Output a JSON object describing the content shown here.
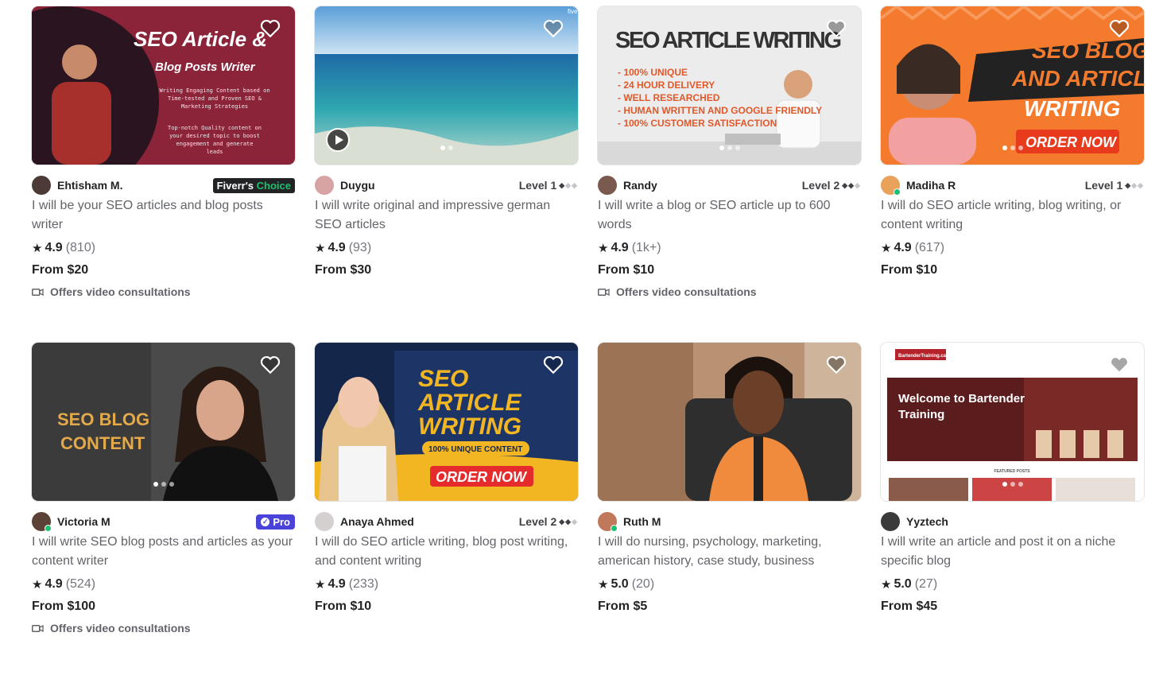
{
  "gigs": [
    {
      "seller": "Ehtisham M.",
      "badge": "choice",
      "badge_text": [
        "Fiverr's",
        "Choice"
      ],
      "title": "I will be your SEO articles and blog posts writer",
      "rating": "4.9",
      "reviews": "(810)",
      "price": "From $20",
      "consult": "Offers video consultations",
      "thumb_text": [
        "SEO Article &",
        "Blog Posts Writer",
        "Writing Engaging Content based on",
        "Time-tested and Proven SEO &",
        "Marketing Strategies",
        "Top-notch Quality content on",
        "your desired topic to boost",
        "engagement and generate",
        "leads"
      ]
    },
    {
      "seller": "Duygu",
      "badge": "level",
      "level": "Level 1",
      "level_n": 1,
      "title": "I will write original and impressive german SEO articles",
      "rating": "4.9",
      "reviews": "(93)",
      "price": "From $30",
      "consult": "",
      "thumb_text": [
        "five"
      ]
    },
    {
      "seller": "Randy",
      "badge": "level",
      "level": "Level 2",
      "level_n": 2,
      "title": "I will write a blog or SEO article up to 600 words",
      "rating": "4.9",
      "reviews": "(1k+)",
      "price": "From $10",
      "consult": "Offers video consultations",
      "thumb_text": [
        "SEO ARTICLE WRITING",
        "- 100% UNIQUE",
        "- 24 HOUR DELIVERY",
        "- WELL RESEARCHED",
        "- HUMAN WRITTEN AND GOOGLE FRIENDLY",
        "- 100% CUSTOMER SATISFACTION"
      ]
    },
    {
      "seller": "Madiha R",
      "badge": "level",
      "level": "Level 1",
      "level_n": 1,
      "title": "I will do SEO article writing, blog writing, or content writing",
      "rating": "4.9",
      "reviews": "(617)",
      "price": "From $10",
      "consult": "",
      "thumb_text": [
        "SEO BLOG",
        "AND ARTICLE",
        "WRITING",
        "ORDER NOW"
      ]
    },
    {
      "seller": "Victoria M",
      "badge": "pro",
      "badge_text": [
        "Pro"
      ],
      "title": "I will write SEO blog posts and articles as your content writer",
      "rating": "4.9",
      "reviews": "(524)",
      "price": "From $100",
      "consult": "Offers video consultations",
      "thumb_text": [
        "SEO BLOG",
        "CONTENT"
      ]
    },
    {
      "seller": "Anaya Ahmed",
      "badge": "level",
      "level": "Level 2",
      "level_n": 2,
      "title": "I will do SEO article writing, blog post writing, and content writing",
      "rating": "4.9",
      "reviews": "(233)",
      "price": "From $10",
      "consult": "",
      "thumb_text": [
        "SEO",
        "ARTICLE",
        "WRITING",
        "100% UNIQUE CONTENT",
        "ORDER NOW"
      ]
    },
    {
      "seller": "Ruth M",
      "badge": "none",
      "title": "I will do nursing, psychology, marketing, american history, case study, business",
      "rating": "5.0",
      "reviews": "(20)",
      "price": "From $5",
      "consult": "",
      "thumb_text": []
    },
    {
      "seller": "Yyztech",
      "badge": "none",
      "title": "I will write an article and post it on a niche specific blog",
      "rating": "5.0",
      "reviews": "(27)",
      "price": "From $45",
      "consult": "",
      "thumb_text": [
        "BartenderTraining.ca",
        "Welcome to Bartender",
        "Training",
        "FEATURED POSTS"
      ]
    }
  ],
  "colors": {
    "accent": "#1dbf73",
    "text": "#404145",
    "pro": "#4a43d9"
  }
}
